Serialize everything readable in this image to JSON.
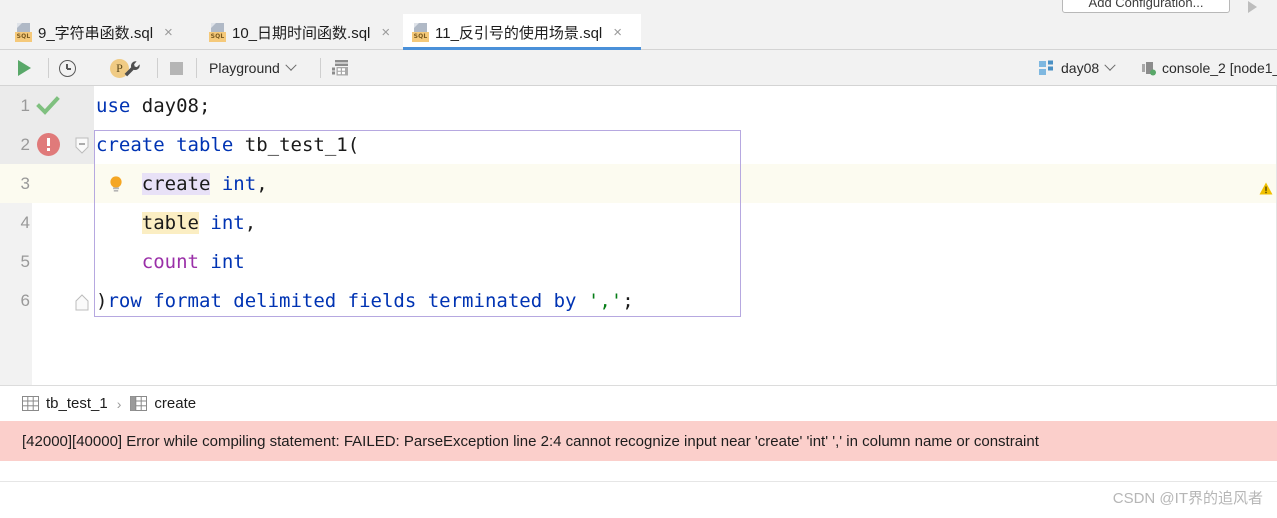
{
  "run_config": {
    "add_configuration_label": "Add Configuration...",
    "run_icon": "run-triangle-icon",
    "debug_icon": "debug-bug-icon",
    "stop_icon": "stop-icon"
  },
  "tabs": [
    {
      "label": "9_字符串函数.sql",
      "icon": "sql-file-icon",
      "badge": "SQL",
      "close": "×",
      "active": false
    },
    {
      "label": "10_日期时间函数.sql",
      "icon": "sql-file-icon",
      "badge": "SQL",
      "close": "×",
      "active": false
    },
    {
      "label": "11_反引号的使用场景.sql",
      "icon": "sql-file-icon",
      "badge": "SQL",
      "close": "×",
      "active": true
    }
  ],
  "toolbar": {
    "run_icon": "execute-run-icon",
    "history_icon": "clock-history-icon",
    "p_badge_label": "P",
    "settings_icon": "wrench-settings-icon",
    "stop_icon": "stop-square-icon",
    "schema_select_label": "Playground",
    "schema_chevron": "chevron-down-icon",
    "grid_icon": "data-grid-icon",
    "database_label": "day08",
    "database_chevron": "chevron-down-icon",
    "database_icon": "database-schema-icon",
    "console_label": "console_2 [node1_",
    "console_icon": "console-connection-icon"
  },
  "editor": {
    "accent_selection_border": "#b6a8e0",
    "lines": [
      {
        "number": "1",
        "gutter_glyph": "green-check-icon",
        "segments": [
          {
            "text": "use",
            "style": "kw"
          },
          {
            "text": " ",
            "style": "plain"
          },
          {
            "text": "day08",
            "style": "ident"
          },
          {
            "text": ";",
            "style": "punct"
          }
        ]
      },
      {
        "number": "2",
        "gutter_glyph": "red-error-icon",
        "fold_glyph": "fold-collapse-icon",
        "segments": [
          {
            "text": "create",
            "style": "kw"
          },
          {
            "text": " ",
            "style": "plain"
          },
          {
            "text": "table",
            "style": "kw"
          },
          {
            "text": " ",
            "style": "plain"
          },
          {
            "text": "tb_test_1",
            "style": "ident"
          },
          {
            "text": "(",
            "style": "punct"
          }
        ]
      },
      {
        "number": "3",
        "gutter_glyph": "yellow-lightbulb-icon",
        "highlighted_row": true,
        "segments": [
          {
            "text": "    ",
            "style": "plain"
          },
          {
            "text": "create",
            "style": "ident-lavender"
          },
          {
            "text": " ",
            "style": "plain"
          },
          {
            "text": "int",
            "style": "kw"
          },
          {
            "text": ",",
            "style": "punct"
          }
        ]
      },
      {
        "number": "4",
        "segments": [
          {
            "text": "    ",
            "style": "plain"
          },
          {
            "text": "table",
            "style": "ident-yellow"
          },
          {
            "text": " ",
            "style": "plain"
          },
          {
            "text": "int",
            "style": "kw"
          },
          {
            "text": ",",
            "style": "punct"
          }
        ]
      },
      {
        "number": "5",
        "segments": [
          {
            "text": "    ",
            "style": "plain"
          },
          {
            "text": "count",
            "style": "func"
          },
          {
            "text": " ",
            "style": "plain"
          },
          {
            "text": "int",
            "style": "kw"
          }
        ]
      },
      {
        "number": "6",
        "fold_glyph": "fold-expand-icon",
        "segments": [
          {
            "text": ")",
            "style": "punct"
          },
          {
            "text": "row format delimited fields terminated by",
            "style": "kw"
          },
          {
            "text": " ",
            "style": "plain"
          },
          {
            "text": "','",
            "style": "str"
          },
          {
            "text": ";",
            "style": "punct"
          }
        ]
      }
    ],
    "margin_warning_icon": "warning-triangle-icon"
  },
  "breadcrumb": {
    "items": [
      {
        "label": "tb_test_1",
        "icon": "table-icon"
      },
      {
        "label": "create",
        "icon": "column-icon"
      }
    ],
    "separator": "›"
  },
  "error": {
    "message": "[42000][40000] Error while compiling statement: FAILED: ParseException line 2:4 cannot recognize input near 'create' 'int' ',' in column name or constraint",
    "background": "#fbcfcb"
  },
  "watermark": {
    "text": "CSDN @IT界的追风者"
  }
}
